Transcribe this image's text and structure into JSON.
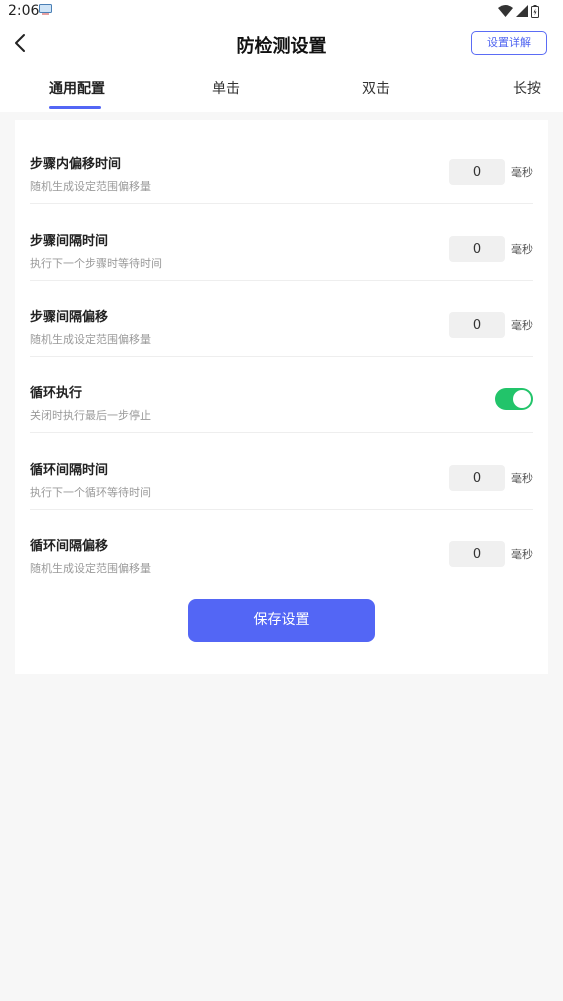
{
  "status": {
    "time": "2:06"
  },
  "header": {
    "title": "防检测设置",
    "detail_label": "设置详解"
  },
  "tabs": [
    {
      "label": "通用配置"
    },
    {
      "label": "单击"
    },
    {
      "label": "双击"
    },
    {
      "label": "长按"
    }
  ],
  "settings": [
    {
      "label": "步骤内偏移时间",
      "sub": "随机生成设定范围偏移量",
      "value": "0",
      "unit": "毫秒"
    },
    {
      "label": "步骤间隔时间",
      "sub": "执行下一个步骤时等待时间",
      "value": "0",
      "unit": "毫秒"
    },
    {
      "label": "步骤间隔偏移",
      "sub": "随机生成设定范围偏移量",
      "value": "0",
      "unit": "毫秒"
    },
    {
      "label": "循环执行",
      "sub": "关闭时执行最后一步停止"
    },
    {
      "label": "循环间隔时间",
      "sub": "执行下一个循环等待时间",
      "value": "0",
      "unit": "毫秒"
    },
    {
      "label": "循环间隔偏移",
      "sub": "随机生成设定范围偏移量",
      "value": "0",
      "unit": "毫秒"
    }
  ],
  "save_label": "保存设置",
  "colors": {
    "accent": "#5366f5",
    "toggle_on": "#22c46a"
  }
}
